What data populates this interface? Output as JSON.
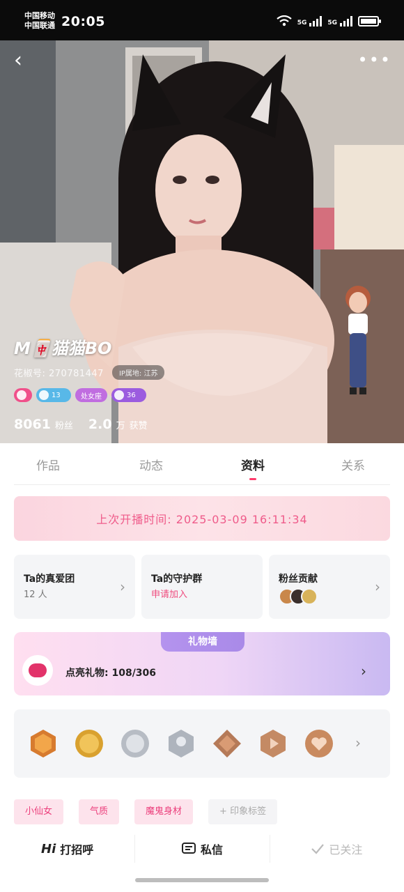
{
  "status_bar": {
    "carrier_1": "中国移动",
    "carrier_2": "中国联通",
    "time": "20:05",
    "network_1": "5G",
    "network_2": "5G"
  },
  "profile": {
    "nickname": "M🀄️猫猫BO",
    "uid_label": "花椒号: 270781447",
    "ip_label": "IP属地: 江苏",
    "badges": [
      {
        "icon": "search-badge-icon",
        "text": ""
      },
      {
        "icon": "diamond-icon",
        "text": "13"
      },
      {
        "icon": "",
        "text": "处女座"
      },
      {
        "icon": "star-icon",
        "text": "36"
      }
    ],
    "fans_count": "8061",
    "fans_label": "粉丝",
    "likes_count": "2.0",
    "likes_unit": "万",
    "likes_label": "获赞"
  },
  "tabs": [
    "作品",
    "动态",
    "资料",
    "关系"
  ],
  "active_tab": "资料",
  "last_live": {
    "text": "上次开播时间: 2025-03-09 16:11:34"
  },
  "cards": {
    "fan_group": {
      "title": "Ta的真爱团",
      "sub": "12 人"
    },
    "guard_group": {
      "title": "Ta的守护群",
      "sub": "申请加入"
    },
    "fan_contribution": {
      "title": "粉丝贡献"
    }
  },
  "gift_wall": {
    "title": "礼物墙",
    "lit_label": "点亮礼物: 108/306"
  },
  "medals": [
    "medal-17-icon",
    "medal-gold-coin-icon",
    "medal-speed-icon",
    "medal-avatar-icon",
    "medal-diamond-icon",
    "medal-play-icon",
    "medal-heart-icon"
  ],
  "tags": [
    "小仙女",
    "气质",
    "魔鬼身材",
    "+ 印象标签"
  ],
  "bottom_bar": {
    "greet_hi": "Hi",
    "greet_label": "打招呼",
    "message_label": "私信",
    "followed_label": "已关注"
  },
  "colors": {
    "accent_pink": "#ef4b7e",
    "gift_purple": "#a98ae8"
  }
}
